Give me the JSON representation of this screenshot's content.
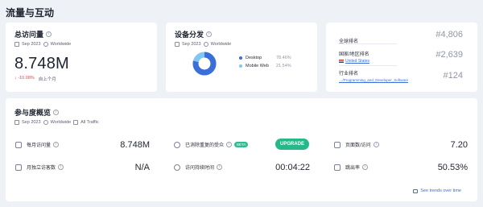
{
  "page": {
    "title": "流量与互动"
  },
  "total_visits": {
    "title": "总访问量",
    "date": "Sep 2023",
    "region": "Worldwide",
    "value": "8.748M",
    "delta": "↓ -10.08%",
    "delta_note": "自上个月"
  },
  "device": {
    "title": "设备分发",
    "date": "Sep 2023",
    "region": "Worldwide",
    "items": [
      {
        "label": "Desktop",
        "pct": "78.46%",
        "color": "#3b6fd8"
      },
      {
        "label": "Mobile Web",
        "pct": "21.54%",
        "color": "#7fc7f2"
      }
    ],
    "desktop_fraction": 0.7846
  },
  "ranks": {
    "global": {
      "label": "全球排名",
      "value": "#4,806"
    },
    "country": {
      "label": "国家/地区排名",
      "sub": "United States",
      "value": "#2,639"
    },
    "category": {
      "label": "行业排名",
      "sub": "…/Programming_and_Developer_Software",
      "value": "#124"
    }
  },
  "engagement": {
    "title": "参与度概览",
    "date": "Sep 2023",
    "region": "Worldwide",
    "traffic": "All Traffic",
    "monthly_visits": {
      "label": "每月访问量",
      "value": "8.748M"
    },
    "dedup_audience": {
      "label": "已消除重复的受众",
      "badge": "BETA",
      "button": "UPGRADE"
    },
    "pages_per_visit": {
      "label": "页面数/访问",
      "value": "7.20"
    },
    "monthly_unique": {
      "label": "月独立访客数",
      "value": "N/A"
    },
    "visit_duration": {
      "label": "访问持续时间",
      "value": "00:04:22"
    },
    "bounce_rate": {
      "label": "跳出率",
      "value": "50.53%"
    },
    "trends_link": "See trends over time"
  }
}
